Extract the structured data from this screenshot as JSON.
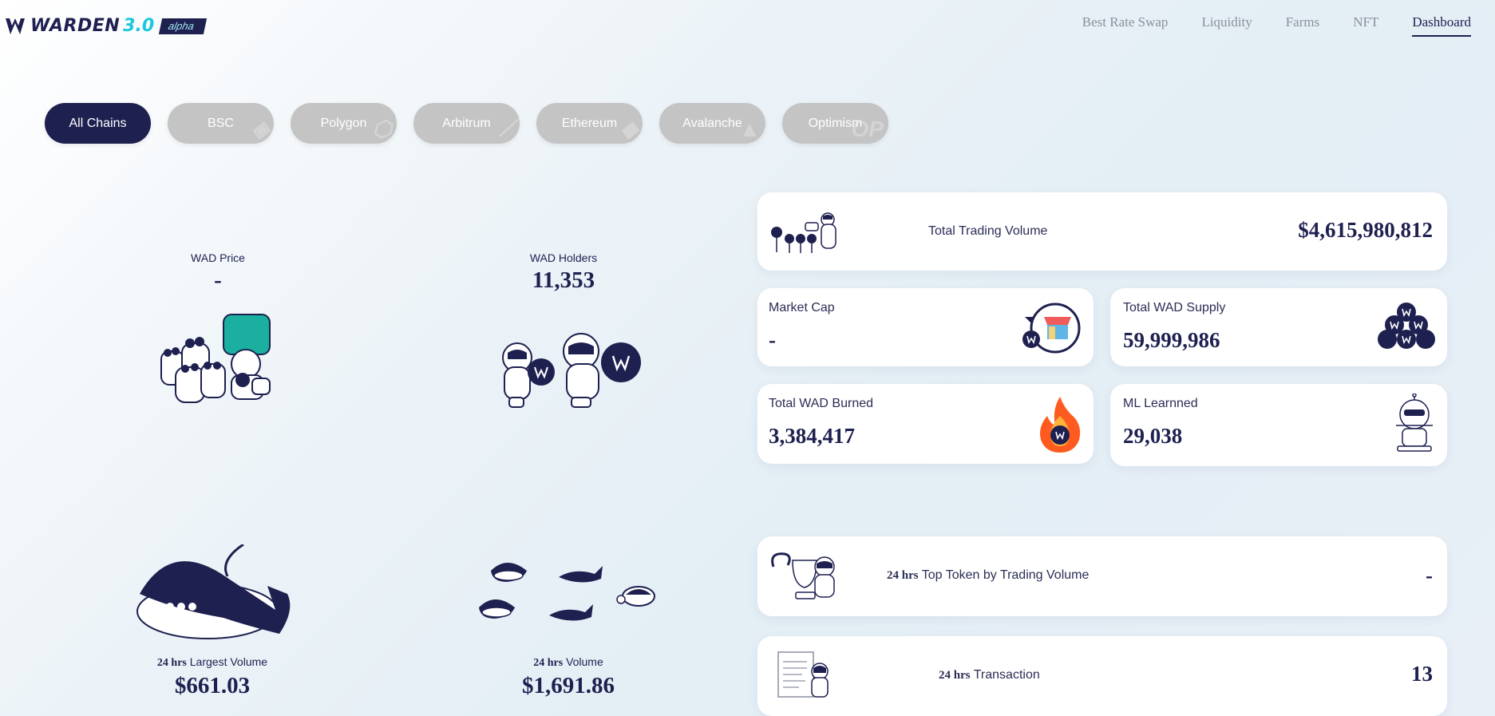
{
  "brand": {
    "name": "WARDEN",
    "version": "3.0",
    "badge": "alpha"
  },
  "nav": [
    {
      "label": "Best Rate Swap",
      "active": false
    },
    {
      "label": "Liquidity",
      "active": false
    },
    {
      "label": "Farms",
      "active": false
    },
    {
      "label": "NFT",
      "active": false
    },
    {
      "label": "Dashboard",
      "active": true
    }
  ],
  "chains": [
    "All Chains",
    "BSC",
    "Polygon",
    "Arbitrum",
    "Ethereum",
    "Avalanche",
    "Optimism"
  ],
  "stats": {
    "wad_price": {
      "label": "WAD Price",
      "value": "-"
    },
    "wad_holders": {
      "label": "WAD Holders",
      "value": "11,353"
    },
    "largest_volume": {
      "prefix": "24 hrs",
      "label": "Largest Volume",
      "value": "$661.03"
    },
    "volume": {
      "prefix": "24 hrs",
      "label": "Volume",
      "value": "$1,691.86"
    }
  },
  "cards": {
    "total_trading_volume": {
      "label": "Total Trading Volume",
      "value": "$4,615,980,812"
    },
    "market_cap": {
      "label": "Market Cap",
      "value": "-"
    },
    "total_supply": {
      "label": "Total WAD Supply",
      "value": "59,999,986"
    },
    "wad_burned": {
      "label": "Total WAD Burned",
      "value": "3,384,417"
    },
    "ml_learned": {
      "label": "ML Learnned",
      "value": "29,038"
    },
    "top_token": {
      "prefix": "24 hrs",
      "label": "Top Token by Trading Volume",
      "value": "-"
    },
    "transaction": {
      "prefix": "24 hrs",
      "label": "Transaction",
      "value": "13"
    }
  },
  "colors": {
    "navy": "#1e2050",
    "accent": "#19c8dc",
    "chip_inactive": "#c4c4c4",
    "flame": "#ff5a1f"
  }
}
